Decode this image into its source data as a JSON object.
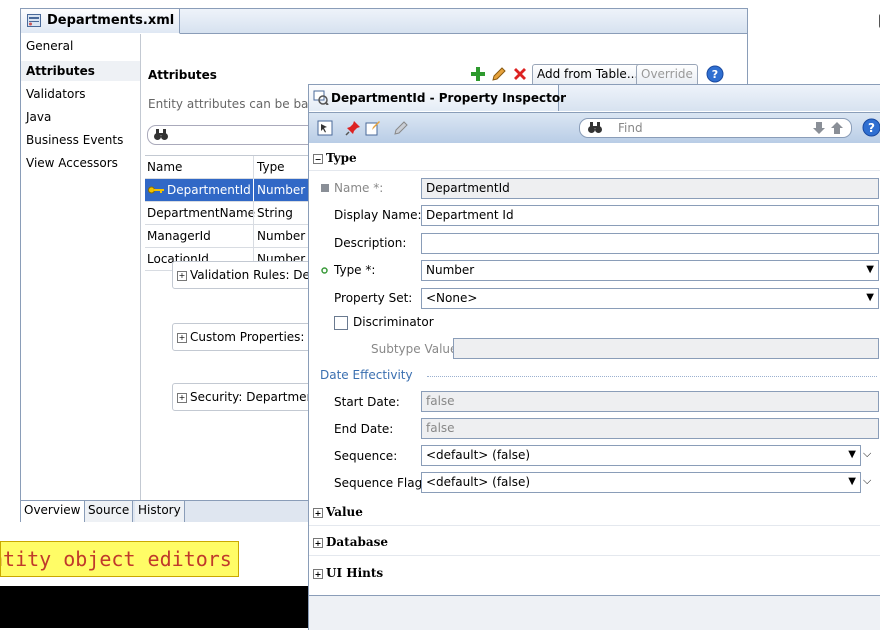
{
  "editor": {
    "tab_title": "Departments.xml",
    "nav_items": [
      "General",
      "Attributes",
      "Validators",
      "Java",
      "Business Events",
      "View Accessors"
    ],
    "section_title": "Attributes",
    "section_desc": "Entity attributes can be base",
    "toolbar": {
      "add_from_table": "Add from Table...",
      "override": "Override"
    },
    "table": {
      "headers": [
        "Name",
        "Type"
      ],
      "rows": [
        {
          "name": "DepartmentId",
          "type": "Number"
        },
        {
          "name": "DepartmentName",
          "type": "String"
        },
        {
          "name": "ManagerId",
          "type": "Number"
        },
        {
          "name": "LocationId",
          "type": "Number"
        }
      ]
    },
    "collapsibles": [
      "Validation Rules: Dep",
      "Custom Properties: D",
      "Security: Departmen"
    ],
    "bottom_tabs": [
      "Overview",
      "Source",
      "History"
    ]
  },
  "caption": "ntity object editors",
  "inspector": {
    "title": "DepartmentId - Property Inspector",
    "find_placeholder": "Find",
    "groups": {
      "type": "Type",
      "value": "Value",
      "database": "Database",
      "ui_hints": "UI Hints"
    },
    "fields": {
      "name_label": "Name *:",
      "name_value": "DepartmentId",
      "display_label": "Display Name:",
      "display_value": "Department Id",
      "desc_label": "Description:",
      "desc_value": "",
      "type_label": "Type *:",
      "type_value": "Number",
      "propset_label": "Property Set:",
      "propset_value": "<None>",
      "discriminator_label": "Discriminator",
      "subtype_label": "Subtype Value:",
      "subtype_value": "",
      "date_eff_label": "Date Effectivity",
      "start_label": "Start Date:",
      "start_value": "false",
      "end_label": "End Date:",
      "end_value": "false",
      "seq_label": "Sequence:",
      "seq_value": "<default> (false)",
      "seqflag_label": "Sequence Flag:",
      "seqflag_value": "<default> (false)"
    }
  },
  "colors": {
    "selection": "#3168c6",
    "caption_bg": "#fffc66",
    "caption_text": "#c0392b"
  }
}
